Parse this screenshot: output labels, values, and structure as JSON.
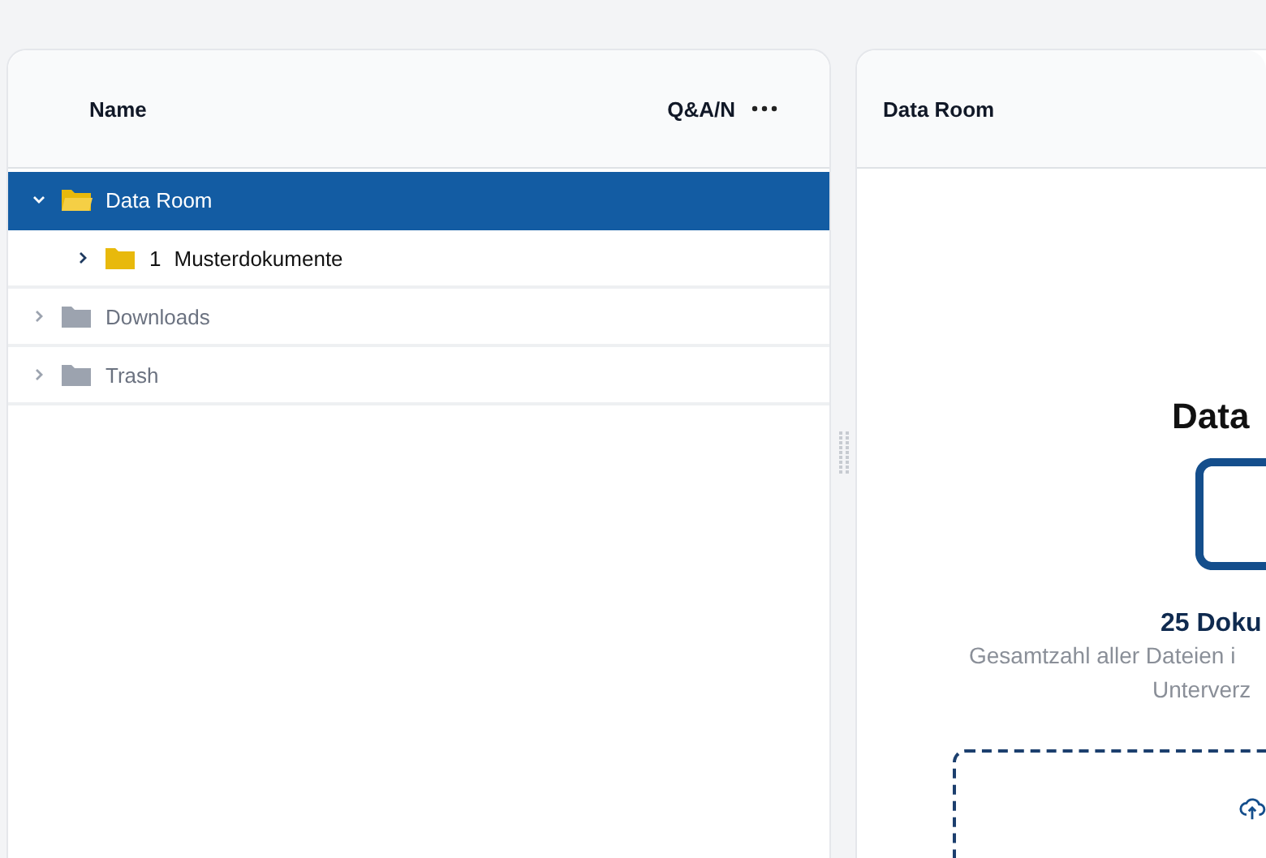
{
  "tree_panel": {
    "columns": [
      {
        "label": "Name"
      },
      {
        "label": "Q&A/N"
      }
    ],
    "items": [
      {
        "label": "Data Room",
        "selected": true,
        "expanded": true,
        "disabled": false,
        "children": [
          {
            "number": "1",
            "label": "Musterdokumente",
            "selected": false,
            "expanded": false,
            "disabled": false
          }
        ]
      },
      {
        "label": "Downloads",
        "selected": false,
        "expanded": false,
        "disabled": true
      },
      {
        "label": "Trash",
        "selected": false,
        "expanded": false,
        "disabled": true
      }
    ]
  },
  "detail_panel": {
    "title": "Data Room",
    "heading": "Data",
    "count": "25 Doku",
    "description": [
      "Gesamtzahl aller Dateien i",
      "Unterverz"
    ]
  }
}
